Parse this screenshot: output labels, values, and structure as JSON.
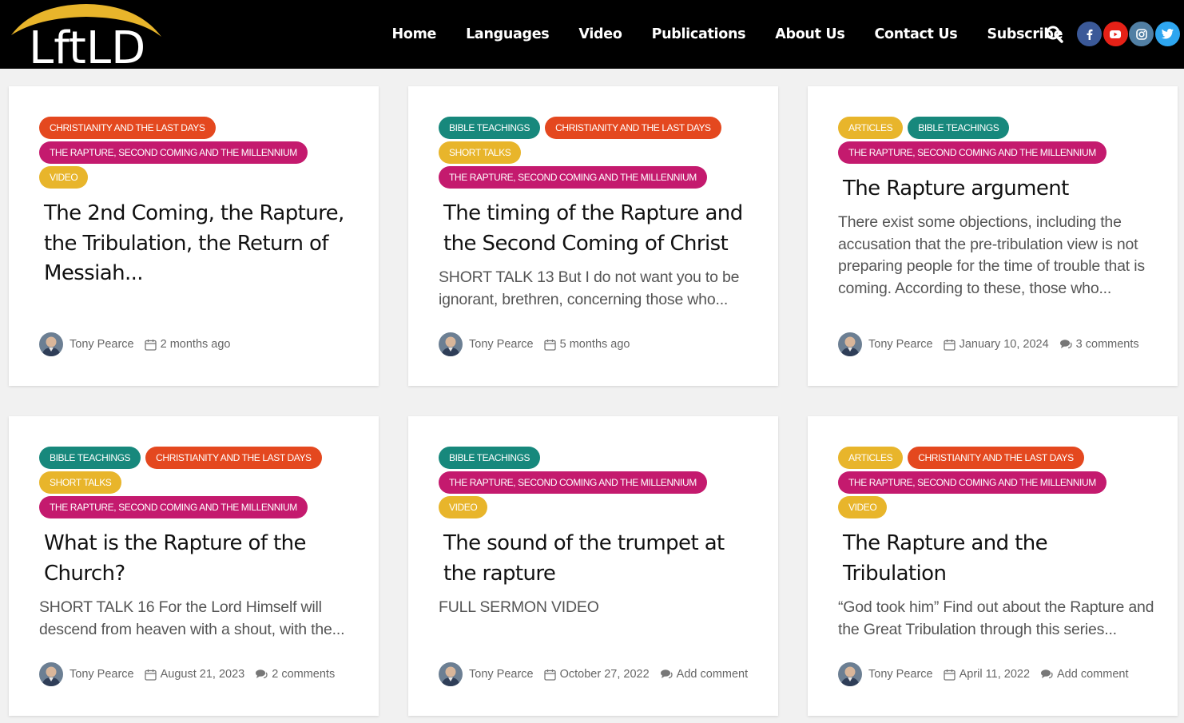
{
  "brand": {
    "logo_text": "LftLD"
  },
  "nav": {
    "items": [
      "Home",
      "Languages",
      "Video",
      "Publications",
      "About Us",
      "Contact Us",
      "Subscribe"
    ]
  },
  "colors": {
    "header_bg": "#000000",
    "tag_christianity": "#e4481f",
    "tag_rapture": "#c41a6e",
    "tag_yellow": "#e8b52b",
    "tag_bible": "#17887c",
    "facebook": "#3b5998",
    "youtube": "#e62117",
    "instagram": "#517fa4",
    "twitter": "#2ea6f0"
  },
  "social_icons": [
    "facebook-icon",
    "youtube-icon",
    "instagram-icon",
    "twitter-icon"
  ],
  "posts": [
    {
      "tags": [
        {
          "label": "CHRISTIANITY AND THE LAST DAYS",
          "color": "#e4481f"
        },
        {
          "label": "THE RAPTURE, SECOND COMING AND THE MILLENNIUM",
          "color": "#c41a6e"
        },
        {
          "label": "VIDEO",
          "color": "#e8b52b"
        }
      ],
      "title": "The 2nd Coming, the Rapture, the Tribulation, the Return of Messiah...",
      "excerpt": "",
      "author": "Tony Pearce",
      "date": "2 months ago",
      "comments": ""
    },
    {
      "tags": [
        {
          "label": "BIBLE TEACHINGS",
          "color": "#17887c"
        },
        {
          "label": "CHRISTIANITY AND THE LAST DAYS",
          "color": "#e4481f"
        },
        {
          "label": "SHORT TALKS",
          "color": "#e8b52b"
        },
        {
          "label": "THE RAPTURE, SECOND COMING AND THE MILLENNIUM",
          "color": "#c41a6e"
        }
      ],
      "title": "The timing of the Rapture and the Second Coming of Christ",
      "excerpt": "SHORT TALK 13 But I do not want you to be ignorant, brethren, concerning those who...",
      "author": "Tony Pearce",
      "date": "5 months ago",
      "comments": ""
    },
    {
      "tags": [
        {
          "label": "ARTICLES",
          "color": "#e8b52b"
        },
        {
          "label": "BIBLE TEACHINGS",
          "color": "#17887c"
        },
        {
          "label": "THE RAPTURE, SECOND COMING AND THE MILLENNIUM",
          "color": "#c41a6e"
        }
      ],
      "title": "The Rapture argument",
      "excerpt": "There exist some objections, including the accusation that the pre-tribulation view is not preparing people for the time of trouble that is coming. According to these, those who...",
      "author": "Tony Pearce",
      "date": "January 10, 2024",
      "comments": "3 comments"
    },
    {
      "tags": [
        {
          "label": "BIBLE TEACHINGS",
          "color": "#17887c"
        },
        {
          "label": "CHRISTIANITY AND THE LAST DAYS",
          "color": "#e4481f"
        },
        {
          "label": "SHORT TALKS",
          "color": "#e8b52b"
        },
        {
          "label": "THE RAPTURE, SECOND COMING AND THE MILLENNIUM",
          "color": "#c41a6e"
        }
      ],
      "title": "What is the Rapture of the Church?",
      "excerpt": "SHORT TALK 16 For the Lord Himself will descend from heaven with a shout, with the...",
      "author": "Tony Pearce",
      "date": "August 21, 2023",
      "comments": "2 comments"
    },
    {
      "tags": [
        {
          "label": "BIBLE TEACHINGS",
          "color": "#17887c"
        },
        {
          "label": "THE RAPTURE, SECOND COMING AND THE MILLENNIUM",
          "color": "#c41a6e"
        },
        {
          "label": "VIDEO",
          "color": "#e8b52b"
        }
      ],
      "title": "The sound of the trumpet at the rapture",
      "excerpt": "FULL SERMON VIDEO",
      "author": "Tony Pearce",
      "date": "October 27, 2022",
      "comments": "Add comment"
    },
    {
      "tags": [
        {
          "label": "ARTICLES",
          "color": "#e8b52b"
        },
        {
          "label": "CHRISTIANITY AND THE LAST DAYS",
          "color": "#e4481f"
        },
        {
          "label": "THE RAPTURE, SECOND COMING AND THE MILLENNIUM",
          "color": "#c41a6e"
        },
        {
          "label": "VIDEO",
          "color": "#e8b52b"
        }
      ],
      "title": "The Rapture and the Tribulation",
      "excerpt": "“God took him” Find out about the Rapture and the Great Tribulation through this series...",
      "author": "Tony Pearce",
      "date": "April 11, 2022",
      "comments": "Add comment"
    }
  ]
}
